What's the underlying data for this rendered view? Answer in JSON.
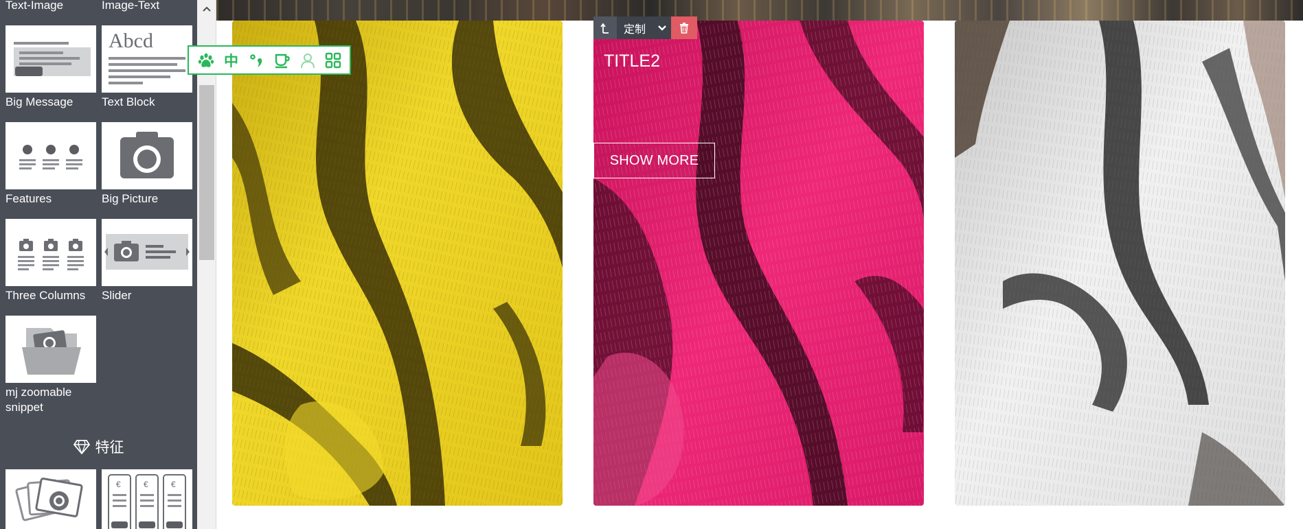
{
  "sidebar": {
    "snippets": [
      {
        "label": "Text-Image"
      },
      {
        "label": "Image-Text"
      },
      {
        "label": "Big Message"
      },
      {
        "label": "Text Block"
      },
      {
        "label": "Features"
      },
      {
        "label": "Big Picture"
      },
      {
        "label": "Three Columns"
      },
      {
        "label": "Slider"
      },
      {
        "label": "mj zoomable snippet"
      }
    ],
    "section_title": "特征",
    "thumb_text": {
      "abcd": "Abcd",
      "currency": "€"
    }
  },
  "float_toolbar": {
    "icons": [
      "paw-icon",
      "chinese-char-icon",
      "dot-comma-icon",
      "cup-icon",
      "user-icon",
      "grid-icon"
    ],
    "cjk_char": "中"
  },
  "canvas": {
    "cards": [
      {
        "name": "yellow-fur",
        "color": "#e9cf1e"
      },
      {
        "name": "pink-fur",
        "color": "#e6196a",
        "title": "TITLE2",
        "button": "SHOW MORE"
      },
      {
        "name": "white-fur",
        "color": "#e8e8e8"
      }
    ]
  },
  "editor_toolbar": {
    "options_label": "定制"
  },
  "colors": {
    "sidebar_bg": "#4a4e57",
    "accent_green": "#29b85a",
    "remove_red": "#e05b63"
  }
}
